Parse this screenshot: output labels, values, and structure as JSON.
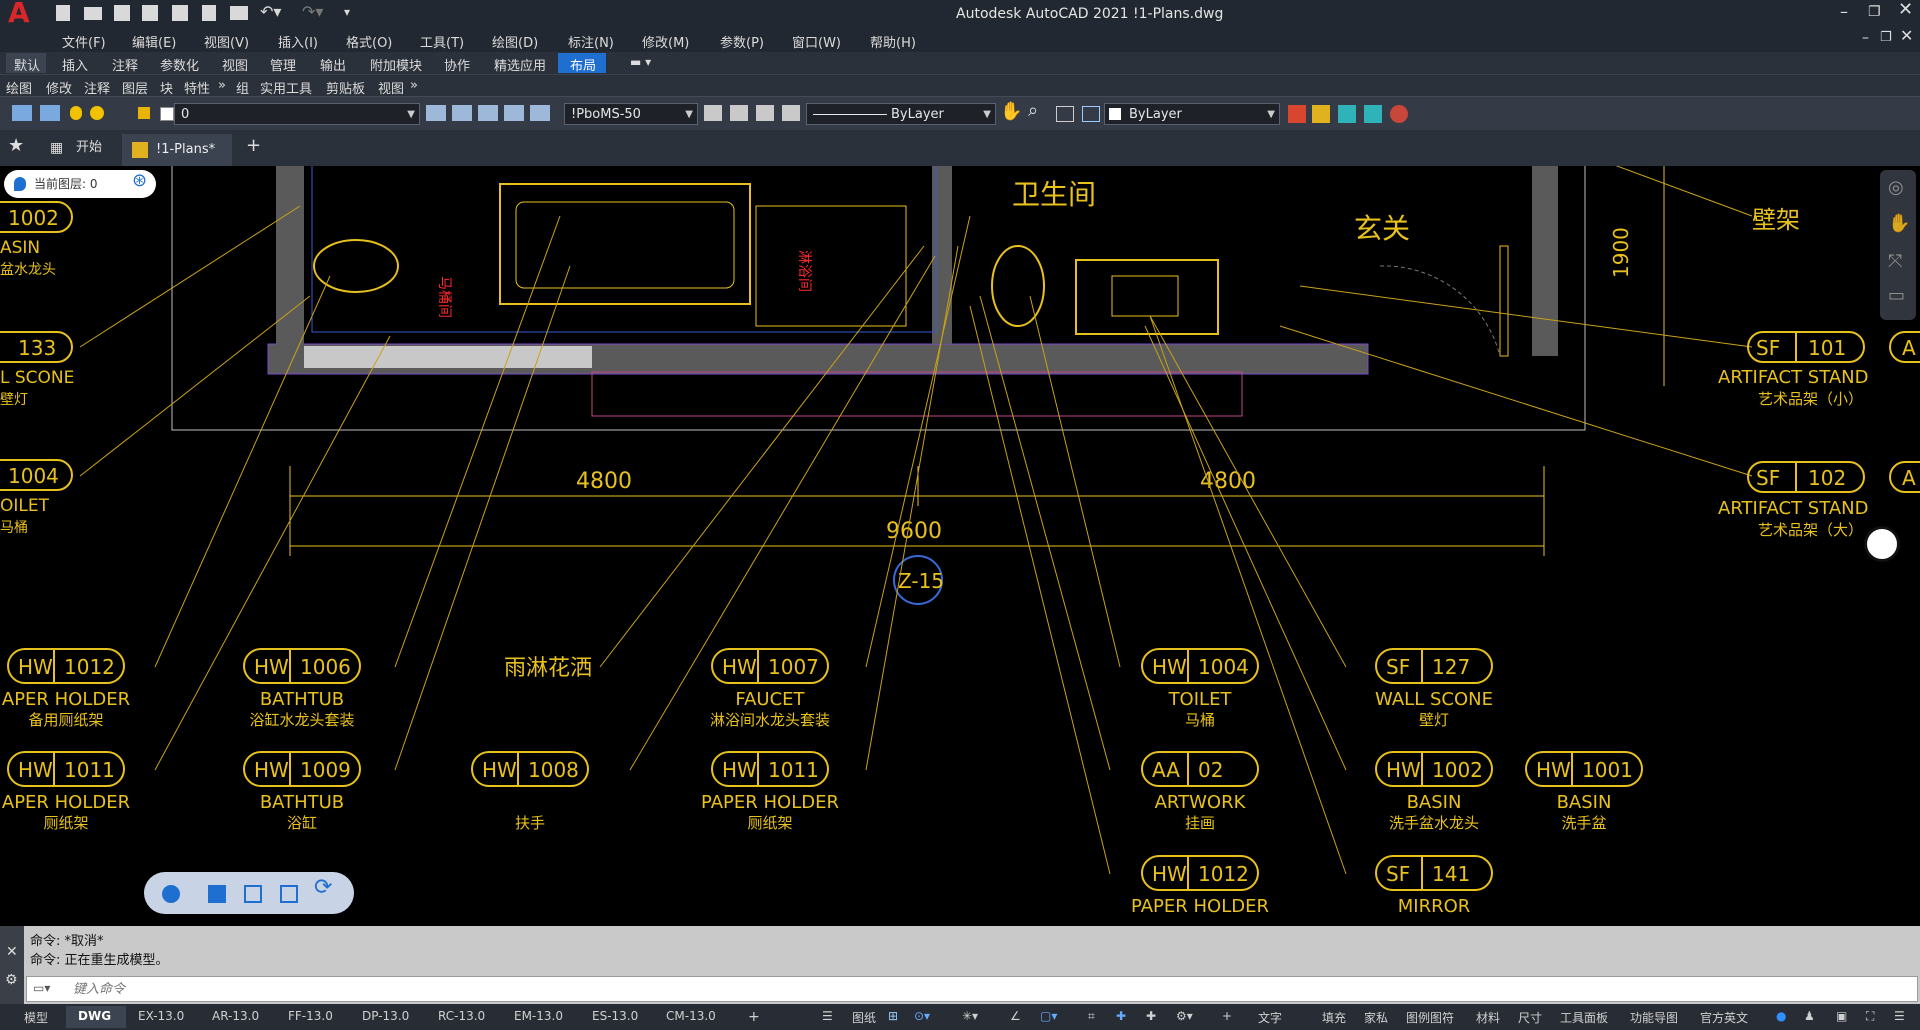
{
  "window": {
    "title": "Autodesk AutoCAD 2021    !1-Plans.dwg",
    "app_logo": "A"
  },
  "menu": [
    "文件(F)",
    "编辑(E)",
    "视图(V)",
    "插入(I)",
    "格式(O)",
    "工具(T)",
    "绘图(D)",
    "标注(N)",
    "修改(M)",
    "参数(P)",
    "窗口(W)",
    "帮助(H)"
  ],
  "ribbon_tabs": [
    "默认",
    "插入",
    "注释",
    "参数化",
    "视图",
    "管理",
    "输出",
    "附加模块",
    "协作",
    "精选应用",
    "布局"
  ],
  "ribbon_active": "布局",
  "panels": [
    "绘图",
    "修改",
    "注释",
    "图层",
    "块",
    "特性",
    "»",
    "组",
    "实用工具",
    "剪贴板",
    "视图",
    "»"
  ],
  "props": {
    "layer_value": "0",
    "dimstyle": "!PboMS-50",
    "linetype": "ByLayer",
    "color": "ByLayer"
  },
  "file_tabs": {
    "start": "开始",
    "doc": "!1-Plans*",
    "add": "+"
  },
  "layer_pill": "当前图层: 0",
  "drawing": {
    "rooms": [
      "卫生间",
      "玄关",
      "壁架",
      "马桶间",
      "淋浴间"
    ],
    "dims": [
      "4800",
      "4800",
      "9600",
      "1900"
    ],
    "grid": "Z-15",
    "left_tags": [
      {
        "code": "1002",
        "line1": "ASIN",
        "line2": "盆水龙头"
      },
      {
        "code": "133",
        "line1": "L SCONE",
        "line2": "壁灯"
      },
      {
        "code": "1004",
        "line1": "OILET",
        "line2": "马桶"
      }
    ],
    "right_tags": [
      {
        "pre": "SF",
        "num": "101",
        "line1": "ARTIFACT STAND",
        "line2": "艺术品架（小）",
        "extra": "A"
      },
      {
        "pre": "SF",
        "num": "102",
        "line1": "ARTIFACT STAND",
        "line2": "艺术品架（大）",
        "extra": "A"
      }
    ],
    "tags": [
      {
        "pre": "HW",
        "num": "1012",
        "line1": "APER HOLDER",
        "line2": "备用厕纸架"
      },
      {
        "pre": "HW",
        "num": "1006",
        "line1": "BATHTUB",
        "line2": "浴缸水龙头套装"
      },
      {
        "pre": "",
        "num": "",
        "line1": "雨淋花洒",
        "line2": ""
      },
      {
        "pre": "HW",
        "num": "1007",
        "line1": "FAUCET",
        "line2": "淋浴间水龙头套装"
      },
      {
        "pre": "HW",
        "num": "1004",
        "line1": "TOILET",
        "line2": "马桶"
      },
      {
        "pre": "SF",
        "num": "127",
        "line1": "WALL SCONE",
        "line2": "壁灯"
      },
      {
        "pre": "HW",
        "num": "1011",
        "line1": "APER HOLDER",
        "line2": "厕纸架"
      },
      {
        "pre": "HW",
        "num": "1009",
        "line1": "BATHTUB",
        "line2": "浴缸"
      },
      {
        "pre": "HW",
        "num": "1008",
        "line1": "",
        "line2": "扶手"
      },
      {
        "pre": "HW",
        "num": "1011",
        "line1": "PAPER HOLDER",
        "line2": "厕纸架"
      },
      {
        "pre": "AA",
        "num": "02",
        "line1": "ARTWORK",
        "line2": "挂画"
      },
      {
        "pre": "HW",
        "num": "1002",
        "line1": "BASIN",
        "line2": "洗手盆水龙头"
      },
      {
        "pre": "HW",
        "num": "1001",
        "line1": "BASIN",
        "line2": "洗手盆"
      },
      {
        "pre": "HW",
        "num": "1012",
        "line1": "PAPER HOLDER",
        "line2": ""
      },
      {
        "pre": "SF",
        "num": "141",
        "line1": "MIRROR",
        "line2": ""
      }
    ]
  },
  "command": {
    "line1": "命令: *取消*",
    "line2": "命令: 正在重生成模型。",
    "placeholder": "键入命令"
  },
  "status": {
    "layout_tabs": [
      "模型",
      "DWG",
      "EX-13.0",
      "AR-13.0",
      "FF-13.0",
      "DP-13.0",
      "RC-13.0",
      "EM-13.0",
      "ES-13.0",
      "CM-13.0",
      "+"
    ],
    "right": [
      "图纸",
      "文字",
      "填充",
      "家私",
      "图例图符",
      "材料",
      "尺寸",
      "工具面板",
      "功能导图",
      "官方英文"
    ]
  },
  "colors": {
    "accent": "#1f6fd1",
    "drawing_yellow": "#e8c11c",
    "wall_gray": "#5a5a5a",
    "titlebar": "#222831"
  }
}
